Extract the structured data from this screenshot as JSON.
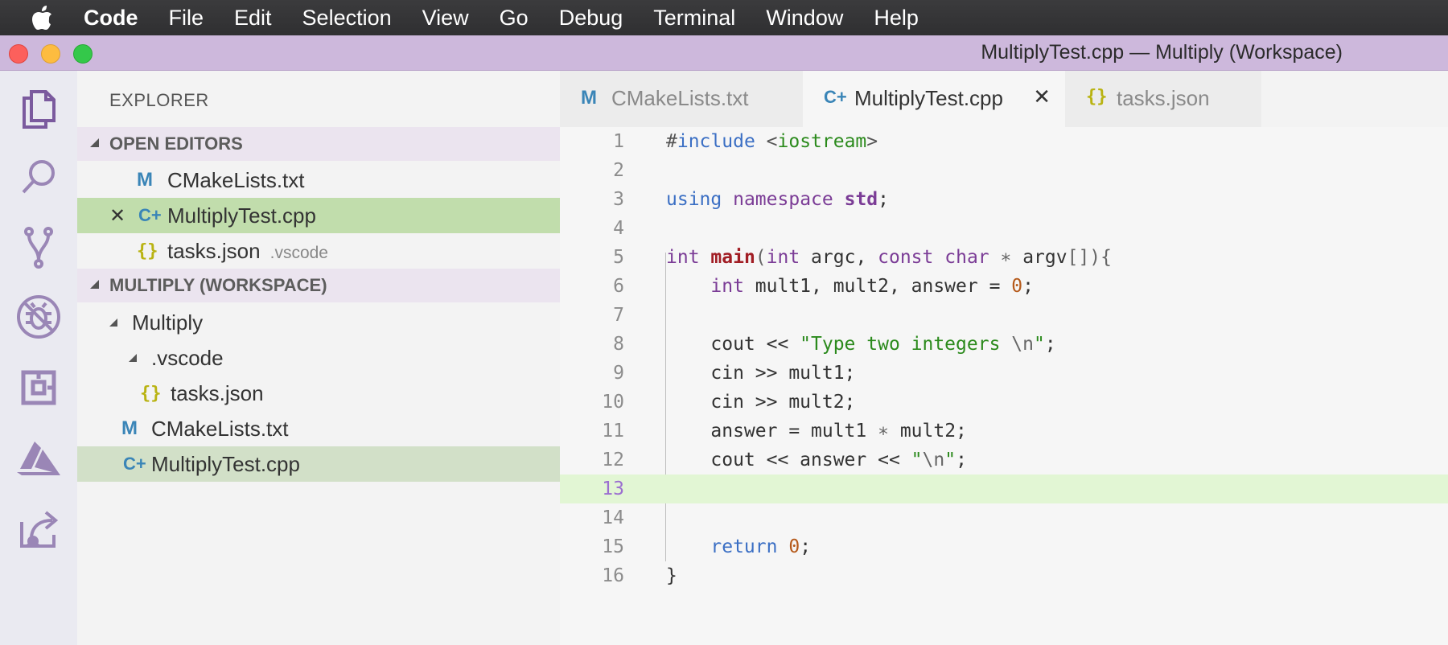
{
  "menubar": {
    "app": "Code",
    "items": [
      "File",
      "Edit",
      "Selection",
      "View",
      "Go",
      "Debug",
      "Terminal",
      "Window",
      "Help"
    ]
  },
  "window": {
    "title": "MultiplyTest.cpp — Multiply (Workspace)"
  },
  "activity_bar": {
    "icons": [
      "explorer-icon",
      "search-icon",
      "source-control-icon",
      "debug-icon",
      "extensions-icon",
      "azure-icon",
      "live-share-icon"
    ]
  },
  "sidebar": {
    "title": "EXPLORER",
    "open_editors": {
      "header": "OPEN EDITORS",
      "items": [
        {
          "icon": "M",
          "label": "CMakeLists.txt",
          "desc": ""
        },
        {
          "icon": "C+",
          "label": "MultiplyTest.cpp",
          "desc": "",
          "close": "✕"
        },
        {
          "icon": "{}",
          "label": "tasks.json",
          "desc": ".vscode"
        }
      ]
    },
    "workspace": {
      "header": "MULTIPLY (WORKSPACE)",
      "items": [
        {
          "label": "Multiply"
        },
        {
          "label": ".vscode"
        },
        {
          "icon": "{}",
          "label": "tasks.json"
        },
        {
          "icon": "M",
          "label": "CMakeLists.txt"
        },
        {
          "icon": "C+",
          "label": "MultiplyTest.cpp"
        }
      ]
    }
  },
  "tabs": [
    {
      "icon": "M",
      "label": "CMakeLists.txt",
      "active": false
    },
    {
      "icon": "C+",
      "label": "MultiplyTest.cpp",
      "active": true,
      "close": "✕"
    },
    {
      "icon": "{}",
      "label": "tasks.json",
      "active": false
    }
  ],
  "editor": {
    "current_line": 13,
    "lines": [
      {
        "n": "1",
        "tokens": [
          [
            "pre",
            "#"
          ],
          [
            "kw",
            "include"
          ],
          [
            "pre",
            " <"
          ],
          [
            "str",
            "iostream"
          ],
          [
            "pre",
            ">"
          ]
        ]
      },
      {
        "n": "2",
        "tokens": []
      },
      {
        "n": "3",
        "tokens": [
          [
            "kw",
            "using"
          ],
          [
            "",
            " "
          ],
          [
            "ty",
            "namespace"
          ],
          [
            "",
            " "
          ],
          [
            "ns",
            "std"
          ],
          [
            "",
            ";"
          ]
        ]
      },
      {
        "n": "4",
        "tokens": []
      },
      {
        "n": "5",
        "tokens": [
          [
            "ty",
            "int"
          ],
          [
            "",
            " "
          ],
          [
            "fn",
            "main"
          ],
          [
            "dim",
            "("
          ],
          [
            "ty",
            "int"
          ],
          [
            "",
            " argc, "
          ],
          [
            "ty",
            "const"
          ],
          [
            "",
            " "
          ],
          [
            "ty",
            "char"
          ],
          [
            "",
            " "
          ],
          [
            "dim",
            "∗"
          ],
          [
            "",
            " argv"
          ],
          [
            "dim",
            "[]){"
          ]
        ]
      },
      {
        "n": "6",
        "tokens": [
          [
            "",
            "    "
          ],
          [
            "ty",
            "int"
          ],
          [
            "",
            " mult1, mult2, answer = "
          ],
          [
            "num",
            "0"
          ],
          [
            "",
            ";"
          ]
        ]
      },
      {
        "n": "7",
        "tokens": []
      },
      {
        "n": "8",
        "tokens": [
          [
            "",
            "    cout << "
          ],
          [
            "str",
            "\"Type two integers "
          ],
          [
            "dim",
            "\\n"
          ],
          [
            "str",
            "\""
          ],
          [
            "",
            ";"
          ]
        ]
      },
      {
        "n": "9",
        "tokens": [
          [
            "",
            "    cin >> mult1;"
          ]
        ]
      },
      {
        "n": "10",
        "tokens": [
          [
            "",
            "    cin >> mult2;"
          ]
        ]
      },
      {
        "n": "11",
        "tokens": [
          [
            "",
            "    answer = mult1 "
          ],
          [
            "dim",
            "∗"
          ],
          [
            "",
            " mult2;"
          ]
        ]
      },
      {
        "n": "12",
        "tokens": [
          [
            "",
            "    cout << answer << "
          ],
          [
            "str",
            "\""
          ],
          [
            "dim",
            "\\n"
          ],
          [
            "str",
            "\""
          ],
          [
            "",
            ";"
          ]
        ]
      },
      {
        "n": "13",
        "tokens": []
      },
      {
        "n": "14",
        "tokens": []
      },
      {
        "n": "15",
        "tokens": [
          [
            "",
            "    "
          ],
          [
            "kw",
            "return"
          ],
          [
            "",
            " "
          ],
          [
            "num",
            "0"
          ],
          [
            "",
            ";"
          ]
        ]
      },
      {
        "n": "16",
        "tokens": [
          [
            "",
            "}"
          ]
        ]
      }
    ]
  }
}
